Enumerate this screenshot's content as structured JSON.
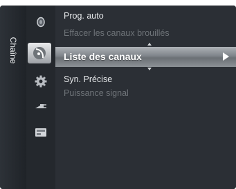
{
  "sidebar": {
    "title": "Chaîne"
  },
  "icons": [
    {
      "name": "picture-icon",
      "active": false
    },
    {
      "name": "channel-icon",
      "active": true
    },
    {
      "name": "setup-gear-icon",
      "active": false
    },
    {
      "name": "input-plug-icon",
      "active": false
    },
    {
      "name": "application-icon",
      "active": false
    }
  ],
  "menu": {
    "items": [
      {
        "label": "Prog. auto",
        "enabled": true
      },
      {
        "label": "Effacer les canaux brouillés",
        "enabled": false
      },
      {
        "label": "Liste des canaux",
        "enabled": true,
        "selected": true
      },
      {
        "label": "Syn. Précise",
        "enabled": true
      },
      {
        "label": "Puissance signal",
        "enabled": false
      }
    ]
  },
  "colors": {
    "background": "#2b2f35",
    "enabled_text": "#e6e8ea",
    "disabled_text": "#6e7378",
    "selection": "#8c9196"
  }
}
